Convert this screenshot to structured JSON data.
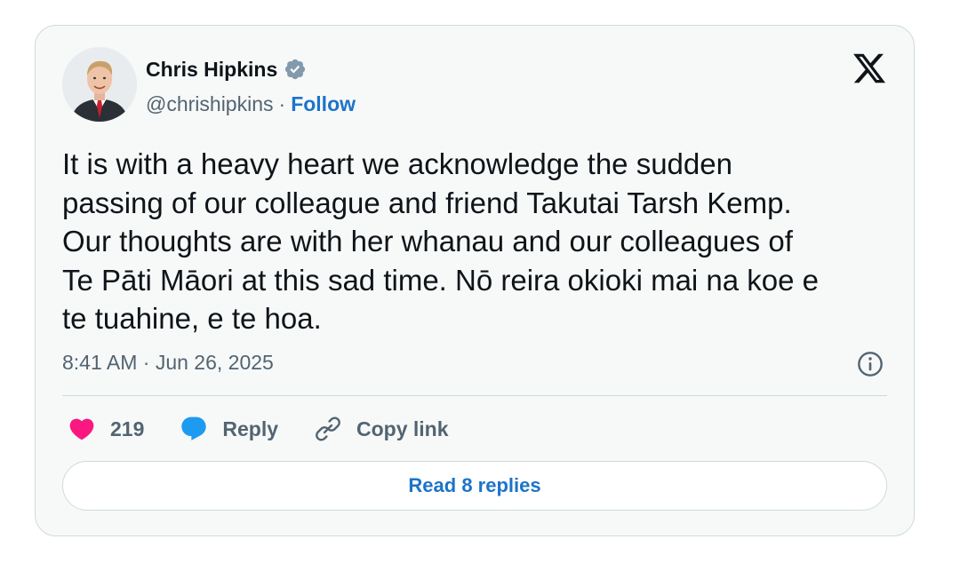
{
  "colors": {
    "link": "#1d74c8",
    "heart": "#f91880",
    "reply": "#1d9bf0",
    "verified_badge": "#829aab",
    "secondary_text": "#536471",
    "primary_text": "#0f1419",
    "border": "#cfd9de",
    "card_background": "#f7f9f9"
  },
  "author": {
    "display_name": "Chris Hipkins",
    "handle": "@chrishipkins",
    "separator": "·",
    "follow_label": "Follow",
    "verified_icon": "verified-badge-icon",
    "avatar": "profile-photo"
  },
  "brand_icon": "x-logo-icon",
  "tweet": {
    "text": "It is with a heavy heart we acknowledge the sudden\npassing of our colleague and friend Takutai Tarsh Kemp.\nOur thoughts are with her whanau and our colleagues of\nTe Pāti Māori at this sad time. Nō reira okioki mai na koe e\nte tuahine, e te hoa.",
    "timestamp": "8:41 AM · Jun 26, 2025",
    "info_icon": "info-icon"
  },
  "actions": {
    "like_count": "219",
    "like_icon": "heart-icon",
    "reply_label": "Reply",
    "reply_icon": "speech-bubble-icon",
    "copy_link_label": "Copy link",
    "copy_link_icon": "link-icon"
  },
  "replies_button": {
    "label": "Read 8 replies"
  }
}
